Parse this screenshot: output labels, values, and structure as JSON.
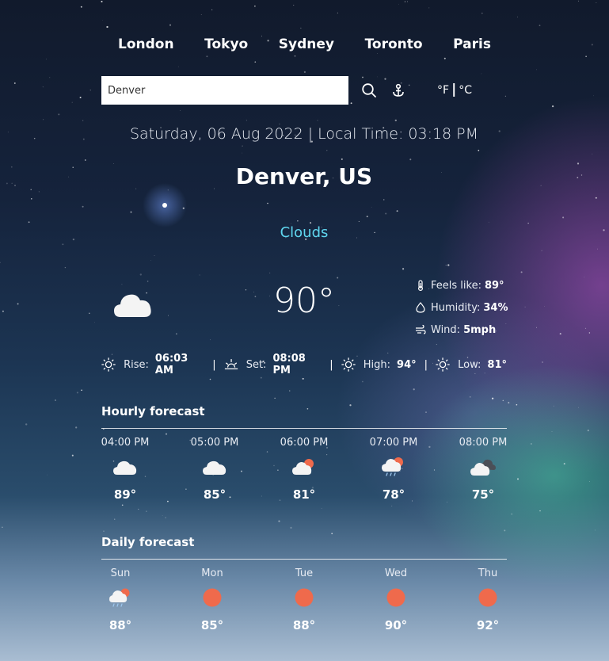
{
  "cities": [
    "London",
    "Tokyo",
    "Sydney",
    "Toronto",
    "Paris"
  ],
  "search": {
    "value": "Denver",
    "placeholder": ""
  },
  "units": {
    "fahrenheit": "°F",
    "separator": "|",
    "celsius": "°C"
  },
  "date_line": "Saturday, 06 Aug 2022 | Local Time: 03:18 PM",
  "location": "Denver, US",
  "condition": "Clouds",
  "current": {
    "temp": "90°",
    "icon": "cloud-icon",
    "feels_like_label": "Feels like:",
    "feels_like": "89°",
    "humidity_label": "Humidity:",
    "humidity": "34%",
    "wind_label": "Wind:",
    "wind": "5mph"
  },
  "sun": {
    "rise_label": "Rise:",
    "rise": "06:03 AM",
    "set_label": "Set:",
    "set": "08:08 PM",
    "high_label": "High:",
    "high": "94°",
    "low_label": "Low:",
    "low": "81°",
    "separator": "|"
  },
  "hourly": {
    "title": "Hourly forecast",
    "items": [
      {
        "label": "04:00 PM",
        "temp": "89°",
        "icon": "cloud-icon"
      },
      {
        "label": "05:00 PM",
        "temp": "85°",
        "icon": "cloud-icon"
      },
      {
        "label": "06:00 PM",
        "temp": "81°",
        "icon": "partly-cloudy-icon"
      },
      {
        "label": "07:00 PM",
        "temp": "78°",
        "icon": "sun-rain-icon"
      },
      {
        "label": "08:00 PM",
        "temp": "75°",
        "icon": "dark-clouds-icon"
      }
    ]
  },
  "daily": {
    "title": "Daily forecast",
    "items": [
      {
        "label": "Sun",
        "temp": "88°",
        "icon": "sun-rain-icon"
      },
      {
        "label": "Mon",
        "temp": "85°",
        "icon": "sun-icon"
      },
      {
        "label": "Tue",
        "temp": "88°",
        "icon": "sun-icon"
      },
      {
        "label": "Wed",
        "temp": "90°",
        "icon": "sun-icon"
      },
      {
        "label": "Thu",
        "temp": "92°",
        "icon": "sun-icon"
      }
    ]
  },
  "colors": {
    "condition": "#5fd6ef",
    "sun": "#ef6a4c",
    "cloud": "#f4f4f4"
  }
}
